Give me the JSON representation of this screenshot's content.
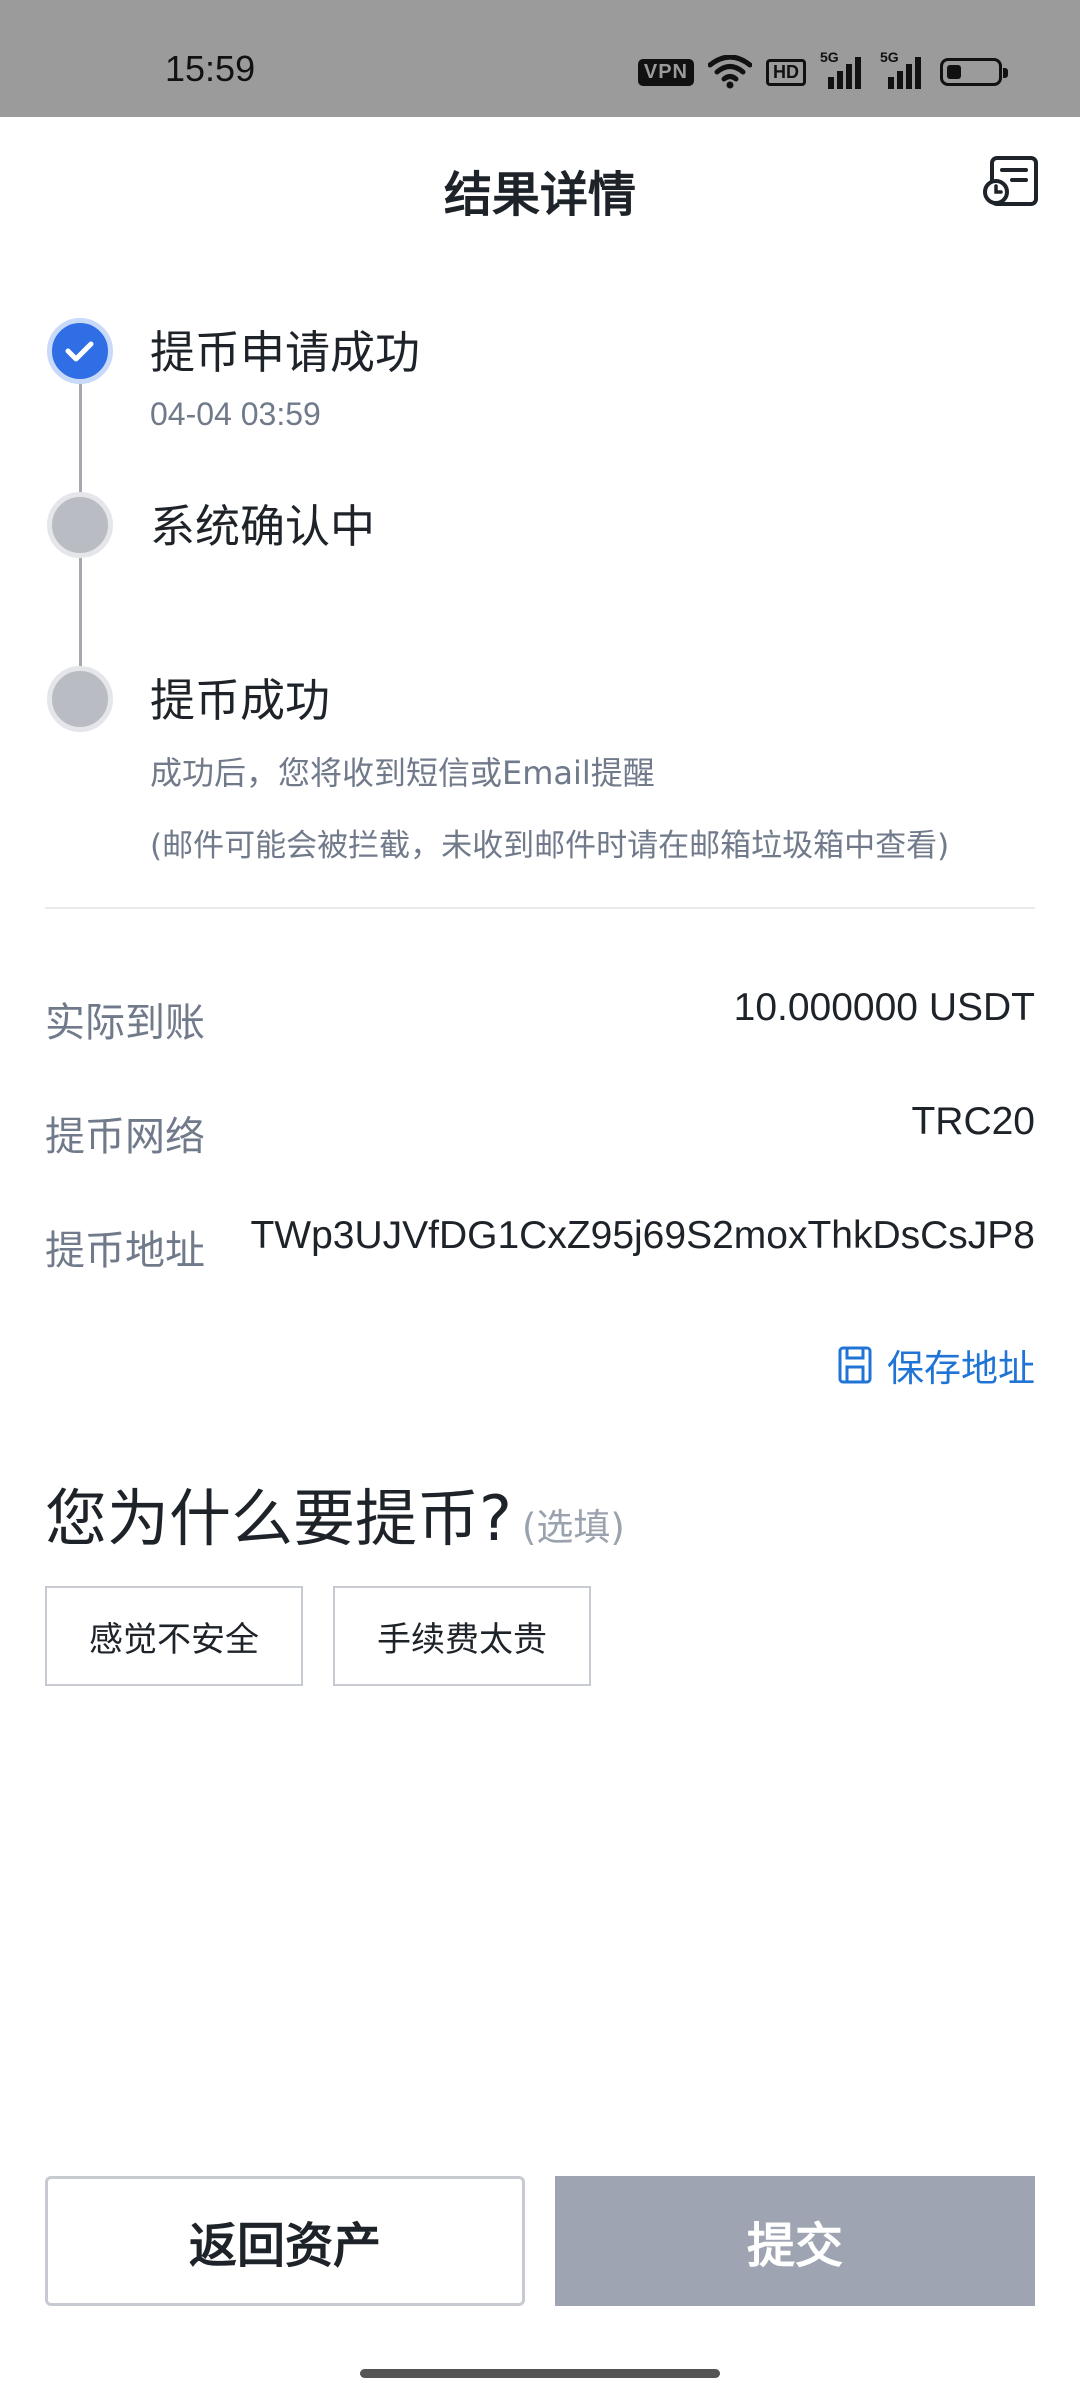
{
  "status_bar": {
    "time": "15:59",
    "vpn_label": "VPN",
    "hd_label": "HD",
    "network_1": "5G",
    "network_2": "5G",
    "battery_level": 0.3,
    "icons": [
      "vpn-icon",
      "wifi-icon",
      "hd-icon",
      "signal-5g-icon",
      "signal-5g-icon",
      "battery-icon"
    ]
  },
  "header": {
    "title": "结果详情",
    "action_icon": "record-list-icon"
  },
  "steps": [
    {
      "title": "提币申请成功",
      "subtitle": "04-04 03:59",
      "state": "done"
    },
    {
      "title": "系统确认中",
      "state": "pending"
    },
    {
      "title": "提币成功",
      "subtitle": "成功后，您将收到短信或Email提醒",
      "note": "(邮件可能会被拦截，未收到邮件时请在邮箱垃圾箱中查看)",
      "state": "pending"
    }
  ],
  "details": {
    "amount_label": "实际到账",
    "amount_value": "10.000000 USDT",
    "network_label": "提币网络",
    "network_value": "TRC20",
    "address_label": "提币地址",
    "address_value": "TWp3UJVfDG1CxZ95j69S2moxThkDsCsJP8",
    "save_address_label": "保存地址"
  },
  "reason": {
    "title": "您为什么要提币?",
    "optional_label": "(选填)",
    "options": [
      "感觉不安全",
      "手续费太贵"
    ]
  },
  "buttons": {
    "back_label": "返回资产",
    "submit_label": "提交"
  },
  "colors": {
    "accent_blue": "#2f6ee5",
    "link_blue": "#1f74d6",
    "pending_gray": "#b9bcc2",
    "disabled_button": "#9ea4b1"
  }
}
